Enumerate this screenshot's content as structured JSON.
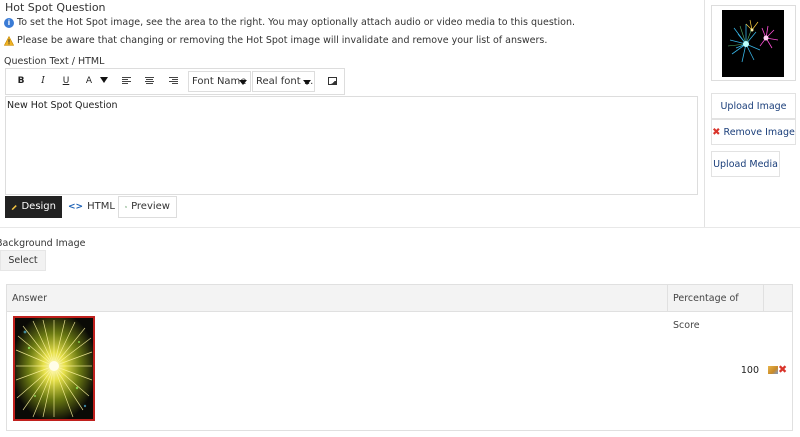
{
  "header": {
    "title": "Hot Spot Question",
    "info_note": "To set the Hot Spot image, see the area to the right. You may optionally attach audio or video media to this question.",
    "warning_note": "Please be aware that changing or removing the Hot Spot image will invalidate and remove your list of answers."
  },
  "editor": {
    "label": "Question Text / HTML",
    "toolbar": {
      "bold": "B",
      "italic": "I",
      "underline": "U",
      "font_color": "A",
      "font_name": "Font Name",
      "font_size": "Real font ..."
    },
    "content": "New Hot Spot Question",
    "tabs": [
      {
        "label": "Design",
        "active": true
      },
      {
        "label": "HTML",
        "active": false
      },
      {
        "label": "Preview",
        "active": false
      }
    ]
  },
  "side_panel": {
    "upload_image": "Upload Image",
    "remove_image": "Remove Image",
    "upload_media": "Upload Media"
  },
  "background": {
    "label": "Background Image",
    "select_button": "Select"
  },
  "answers_table": {
    "columns": [
      "Answer",
      "Percentage of Score"
    ],
    "rows": [
      {
        "percentage": "100"
      }
    ]
  },
  "colors": {
    "active_tab": "#222222",
    "link": "#1a3e7a",
    "delete": "#d9342b",
    "hotspot_border": "#c0201d"
  }
}
